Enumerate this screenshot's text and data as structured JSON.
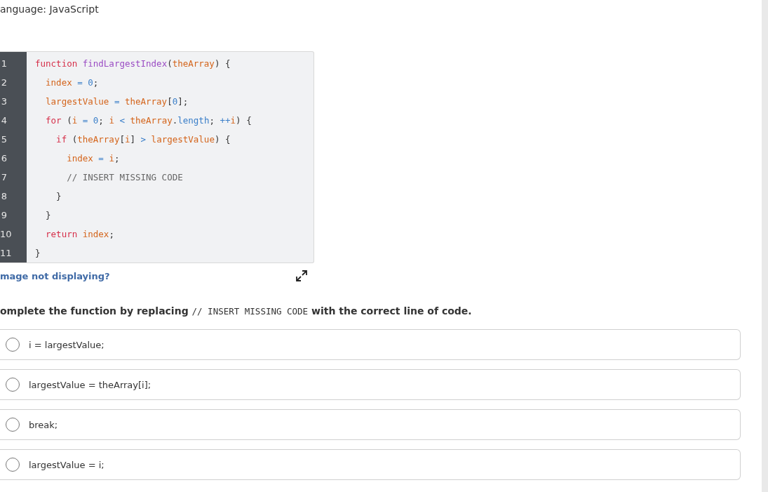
{
  "language_label": "anguage: JavaScript",
  "code": {
    "lines": [
      {
        "number": "1",
        "tokens": [
          {
            "kind": "keyword",
            "text": "function"
          },
          {
            "kind": "function",
            "text": " findLargestIndex"
          },
          {
            "kind": "punct",
            "text": "("
          },
          {
            "kind": "variable",
            "text": "theArray"
          },
          {
            "kind": "punct",
            "text": ") {"
          }
        ]
      },
      {
        "number": "2",
        "tokens": [
          {
            "kind": "variable",
            "text": "  index"
          },
          {
            "kind": "operator",
            "text": " = "
          },
          {
            "kind": "number",
            "text": "0"
          },
          {
            "kind": "punct",
            "text": ";"
          }
        ]
      },
      {
        "number": "3",
        "tokens": [
          {
            "kind": "variable",
            "text": "  largestValue"
          },
          {
            "kind": "operator",
            "text": " = "
          },
          {
            "kind": "variable",
            "text": "theArray"
          },
          {
            "kind": "punct",
            "text": "["
          },
          {
            "kind": "number",
            "text": "0"
          },
          {
            "kind": "punct",
            "text": "];"
          }
        ]
      },
      {
        "number": "4",
        "tokens": [
          {
            "kind": "keyword",
            "text": "  for"
          },
          {
            "kind": "punct",
            "text": " ("
          },
          {
            "kind": "variable",
            "text": "i"
          },
          {
            "kind": "operator",
            "text": " = "
          },
          {
            "kind": "number",
            "text": "0"
          },
          {
            "kind": "punct",
            "text": "; "
          },
          {
            "kind": "variable",
            "text": "i"
          },
          {
            "kind": "operator",
            "text": " < "
          },
          {
            "kind": "variable",
            "text": "theArray"
          },
          {
            "kind": "punct",
            "text": "."
          },
          {
            "kind": "property",
            "text": "length"
          },
          {
            "kind": "punct",
            "text": "; "
          },
          {
            "kind": "operator",
            "text": "++"
          },
          {
            "kind": "variable",
            "text": "i"
          },
          {
            "kind": "punct",
            "text": ") {"
          }
        ]
      },
      {
        "number": "5",
        "tokens": [
          {
            "kind": "keyword",
            "text": "    if"
          },
          {
            "kind": "punct",
            "text": " ("
          },
          {
            "kind": "variable",
            "text": "theArray"
          },
          {
            "kind": "punct",
            "text": "["
          },
          {
            "kind": "variable",
            "text": "i"
          },
          {
            "kind": "punct",
            "text": "]"
          },
          {
            "kind": "operator",
            "text": " > "
          },
          {
            "kind": "variable",
            "text": "largestValue"
          },
          {
            "kind": "punct",
            "text": ") {"
          }
        ]
      },
      {
        "number": "6",
        "tokens": [
          {
            "kind": "variable",
            "text": "      index"
          },
          {
            "kind": "operator",
            "text": " = "
          },
          {
            "kind": "variable",
            "text": "i"
          },
          {
            "kind": "punct",
            "text": ";"
          }
        ]
      },
      {
        "number": "7",
        "tokens": [
          {
            "kind": "comment",
            "text": "      // INSERT MISSING CODE"
          }
        ]
      },
      {
        "number": "8",
        "tokens": [
          {
            "kind": "punct",
            "text": "    }"
          }
        ]
      },
      {
        "number": "9",
        "tokens": [
          {
            "kind": "punct",
            "text": "  }"
          }
        ]
      },
      {
        "number": "10",
        "tokens": [
          {
            "kind": "keyword",
            "text": "  return"
          },
          {
            "kind": "variable",
            "text": " index"
          },
          {
            "kind": "punct",
            "text": ";"
          }
        ]
      },
      {
        "number": "11",
        "tokens": [
          {
            "kind": "punct",
            "text": "}"
          }
        ]
      }
    ]
  },
  "image_link": "mage not displaying?",
  "question": [
    {
      "kind": "text",
      "text": "omplete the function by replacing "
    },
    {
      "kind": "code",
      "text": "// INSERT MISSING CODE"
    },
    {
      "kind": "text",
      "text": " with the correct line of code."
    }
  ],
  "options": [
    {
      "label": "i = largestValue;",
      "selected": false
    },
    {
      "label": "largestValue = theArray[i];",
      "selected": false
    },
    {
      "label": "break;",
      "selected": false
    },
    {
      "label": "largestValue = i;",
      "selected": false
    }
  ]
}
